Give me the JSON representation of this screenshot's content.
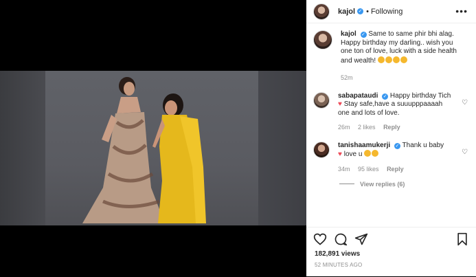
{
  "post": {
    "username": "kajol",
    "follow_status": "Following",
    "more_label": "•••"
  },
  "comments": [
    {
      "username": "kajol",
      "text": "Same to same phir bhi alag. Happy birthday my darling.. wish you one ton of love, luck with a side health and wealth!",
      "emoji_count": 4,
      "time": "52m"
    },
    {
      "username": "sabapataudi",
      "text_before": "Happy birthday Tich",
      "text_after": "Stay safe,have a suuupppaaaah one and lots of love.",
      "time": "26m",
      "likes": "2 likes",
      "reply": "Reply"
    },
    {
      "username": "tanishaamukerji",
      "text_before": "Thank u baby",
      "text_after": "love u",
      "time": "34m",
      "likes": "95 likes",
      "reply": "Reply",
      "view_replies": "View replies (6)"
    }
  ],
  "stats": {
    "likes": "182,891 views",
    "time_ago": "52 MINUTES AGO"
  }
}
